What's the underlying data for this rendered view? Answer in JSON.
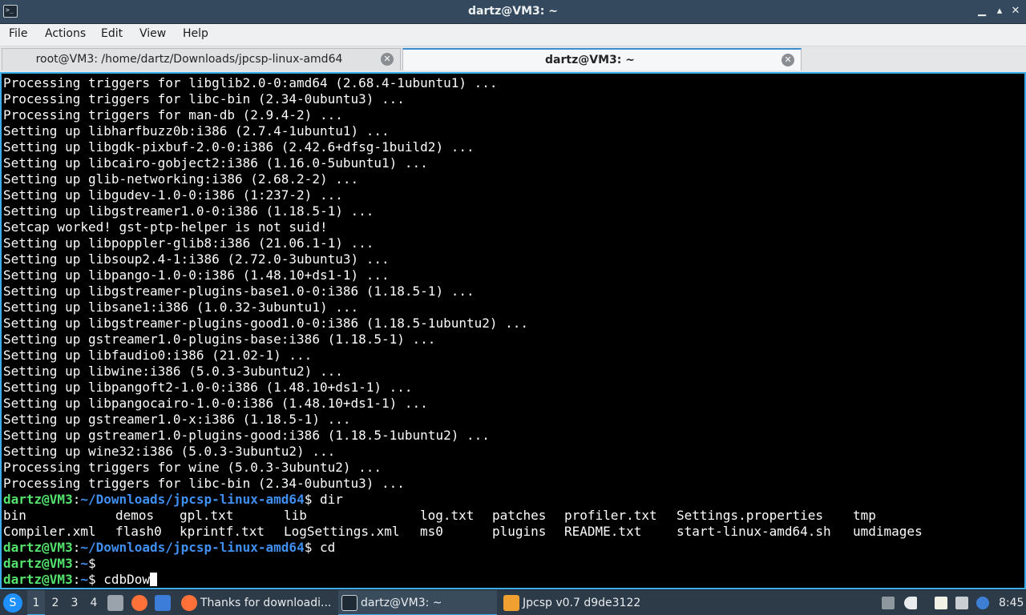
{
  "window": {
    "title": "dartz@VM3: ~",
    "minimize_glyph": "▁",
    "maximize_glyph": "▴",
    "close_glyph": "✕",
    "app_icon_glyph": ">_"
  },
  "menu": [
    "File",
    "Actions",
    "Edit",
    "View",
    "Help"
  ],
  "tabs": [
    {
      "label": "root@VM3: /home/dartz/Downloads/jpcsp-linux-amd64",
      "active": false
    },
    {
      "label": "dartz@VM3: ~",
      "active": true
    }
  ],
  "tab_close_glyph": "✕",
  "terminal": {
    "output_lines": [
      "Processing triggers for libglib2.0-0:amd64 (2.68.4-1ubuntu1) ...",
      "Processing triggers for libc-bin (2.34-0ubuntu3) ...",
      "Processing triggers for man-db (2.9.4-2) ...",
      "Setting up libharfbuzz0b:i386 (2.7.4-1ubuntu1) ...",
      "Setting up libgdk-pixbuf-2.0-0:i386 (2.42.6+dfsg-1build2) ...",
      "Setting up libcairo-gobject2:i386 (1.16.0-5ubuntu1) ...",
      "Setting up glib-networking:i386 (2.68.2-2) ...",
      "Setting up libgudev-1.0-0:i386 (1:237-2) ...",
      "Setting up libgstreamer1.0-0:i386 (1.18.5-1) ...",
      "Setcap worked! gst-ptp-helper is not suid!",
      "Setting up libpoppler-glib8:i386 (21.06.1-1) ...",
      "Setting up libsoup2.4-1:i386 (2.72.0-3ubuntu3) ...",
      "Setting up libpango-1.0-0:i386 (1.48.10+ds1-1) ...",
      "Setting up libgstreamer-plugins-base1.0-0:i386 (1.18.5-1) ...",
      "Setting up libsane1:i386 (1.0.32-3ubuntu1) ...",
      "Setting up libgstreamer-plugins-good1.0-0:i386 (1.18.5-1ubuntu2) ...",
      "Setting up gstreamer1.0-plugins-base:i386 (1.18.5-1) ...",
      "Setting up libfaudio0:i386 (21.02-1) ...",
      "Setting up libwine:i386 (5.0.3-3ubuntu2) ...",
      "Setting up libpangoft2-1.0-0:i386 (1.48.10+ds1-1) ...",
      "Setting up libpangocairo-1.0-0:i386 (1.48.10+ds1-1) ...",
      "Setting up gstreamer1.0-x:i386 (1.18.5-1) ...",
      "Setting up gstreamer1.0-plugins-good:i386 (1.18.5-1ubuntu2) ...",
      "Setting up wine32:i386 (5.0.3-3ubuntu2) ...",
      "Processing triggers for wine (5.0.3-3ubuntu2) ...",
      "Processing triggers for libc-bin (2.34-0ubuntu3) ..."
    ],
    "prompt_user": "dartz@VM3",
    "prompt_sep": ":",
    "prompt_end": "$ ",
    "cmd1": {
      "path": "~/Downloads/jpcsp-linux-amd64",
      "command": "dir"
    },
    "dir_rows": [
      [
        "bin",
        "demos",
        "gpl.txt",
        "lib",
        "log.txt",
        "patches",
        "profiler.txt",
        "Settings.properties",
        "tmp"
      ],
      [
        "Compiler.xml",
        "flash0",
        "kprintf.txt",
        "LogSettings.xml",
        "ms0",
        "plugins",
        "README.txt",
        "start-linux-amd64.sh",
        "umdimages"
      ]
    ],
    "cmd2": {
      "path": "~/Downloads/jpcsp-linux-amd64",
      "command": "cd"
    },
    "cmd3": {
      "path": "~",
      "command": ""
    },
    "cmd4": {
      "path": "~",
      "command": "cdbDow"
    }
  },
  "taskbar": {
    "start_glyph": "S",
    "workspaces": [
      "1",
      "2",
      "3",
      "4"
    ],
    "active_workspace": "1",
    "tasks": [
      {
        "label": "Thanks for downloadi...",
        "icon": "firefox-icon",
        "active": false
      },
      {
        "label": "dartz@VM3: ~",
        "icon": "terminal-icon",
        "active": true
      },
      {
        "label": "Jpcsp v0.7 d9de3122",
        "icon": "jpcsp-icon",
        "active": false
      }
    ],
    "clock": "8:45",
    "colors": {
      "firefox": "#ff7139",
      "accent": "#3daee9",
      "start": "#1e90ff"
    }
  }
}
